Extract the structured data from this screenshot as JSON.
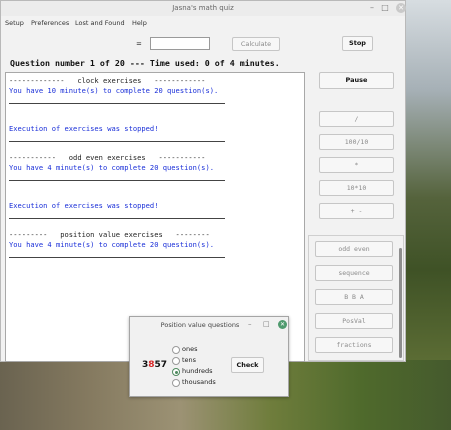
{
  "window": {
    "title": "Jasna's math quiz"
  },
  "menu": [
    "Setup",
    "Preferences",
    "Lost and Found",
    "Help"
  ],
  "toolbar": {
    "equals": "=",
    "answer_value": "",
    "calculate_label": "Calculate",
    "stop_label": "Stop"
  },
  "status": "Question number 1 of 20 --- Time used: 0 of 4 minutes.",
  "right_buttons": {
    "pause": "Pause",
    "ops": [
      "/",
      "100/10",
      "*",
      "10*10",
      "+ -"
    ],
    "exercises": [
      "odd even",
      "sequence",
      "B B A",
      "PosVal",
      "fractions"
    ]
  },
  "log": {
    "clock_header": "-------------   clock exercises   ------------",
    "clock_info": "You have 10 minute(s) to complete 20 question(s).",
    "stopped1": "Execution of exercises was stopped!",
    "odd_header": "-----------   odd even exercises   -----------",
    "odd_info": "You have 4 minute(s) to complete 20 question(s).",
    "stopped2": "Execution of exercises was stopped!",
    "pos_header": "---------   position value exercises   --------",
    "pos_info": "You have 4 minute(s) to complete 20 question(s)."
  },
  "dialog": {
    "title": "Position value questions",
    "digits": [
      "3",
      "8",
      "5",
      "7"
    ],
    "highlight_index": 1,
    "options": [
      "ones",
      "tens",
      "hundreds",
      "thousands"
    ],
    "selected": "hundreds",
    "check_label": "Check"
  },
  "colors": {
    "log_text": "#1a2fd8",
    "highlight_digit": "#d62828",
    "dialog_close": "#4f9a6e"
  }
}
